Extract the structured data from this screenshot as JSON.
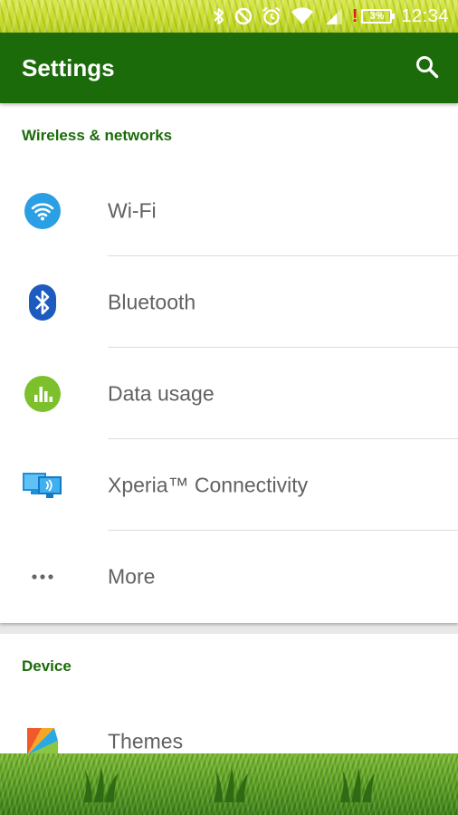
{
  "status_bar": {
    "time": "12:34",
    "battery_percent": "3%",
    "battery_alert": "!",
    "icons": [
      "bluetooth-icon",
      "do-not-disturb-icon",
      "alarm-icon",
      "wifi-icon",
      "cell-signal-icon",
      "battery-icon"
    ]
  },
  "toolbar": {
    "title": "Settings",
    "search_icon": "search-icon"
  },
  "sections": [
    {
      "header": "Wireless & networks",
      "items": [
        {
          "label": "Wi-Fi",
          "icon": "wifi-settings-icon",
          "color": "#2a9fe3"
        },
        {
          "label": "Bluetooth",
          "icon": "bluetooth-settings-icon",
          "color": "#1e5bbf"
        },
        {
          "label": "Data usage",
          "icon": "data-usage-icon",
          "color": "#7cc02c"
        },
        {
          "label": "Xperia™ Connectivity",
          "icon": "xperia-connectivity-icon",
          "color": "#1d8fd8"
        },
        {
          "label": "More",
          "icon": "more-dots-icon",
          "color": "#666666"
        }
      ]
    },
    {
      "header": "Device",
      "items": [
        {
          "label": "Themes",
          "icon": "themes-icon",
          "color": "#f0592a"
        }
      ]
    }
  ],
  "colors": {
    "toolbar": "#1b6b0b",
    "section_header": "#1b6b0b",
    "item_text": "#616161"
  }
}
